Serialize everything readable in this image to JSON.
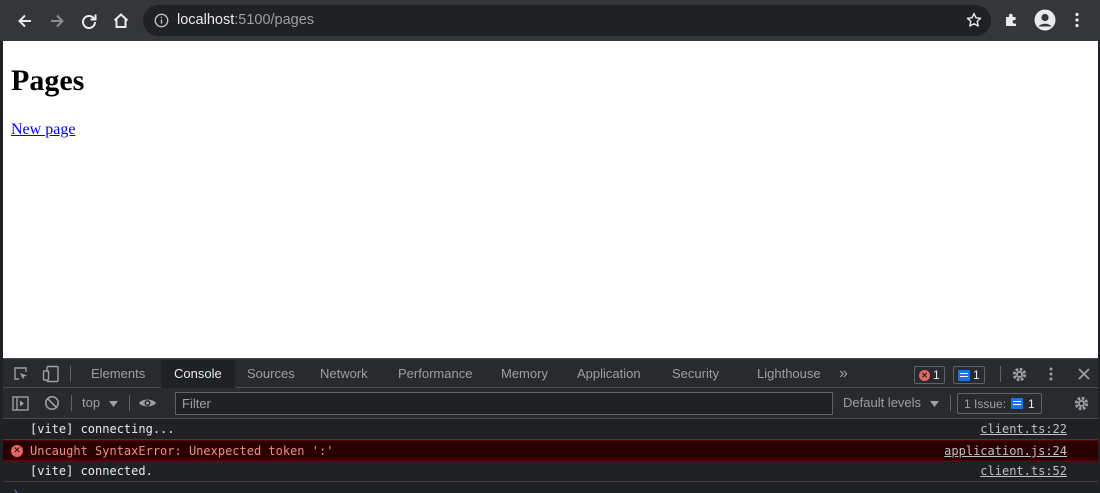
{
  "browser": {
    "url_host": "localhost",
    "url_rest": ":5100/pages"
  },
  "page": {
    "title": "Pages",
    "link_text": "New page"
  },
  "devtools": {
    "tabs": [
      {
        "label": "Elements"
      },
      {
        "label": "Console"
      },
      {
        "label": "Sources"
      },
      {
        "label": "Network"
      },
      {
        "label": "Performance"
      },
      {
        "label": "Memory"
      },
      {
        "label": "Application"
      },
      {
        "label": "Security"
      },
      {
        "label": "Lighthouse"
      }
    ],
    "active_tab": "Console",
    "overflow_label": "»",
    "error_count": "1",
    "message_count": "1",
    "context": "top",
    "filter_placeholder": "Filter",
    "levels_label": "Default levels",
    "issues_label": "1 Issue:",
    "issues_count": "1",
    "console": [
      {
        "text": "[vite] connecting...",
        "source": "client.ts:22",
        "level": "info"
      },
      {
        "text": "Uncaught SyntaxError: Unexpected token ':'",
        "source": "application.js:24",
        "level": "error"
      },
      {
        "text": "[vite] connected.",
        "source": "client.ts:52",
        "level": "info"
      }
    ]
  },
  "colors": {
    "toolbar": "#35363a",
    "devtools_bg": "#202124",
    "error_bg": "#290000",
    "error_text": "#f28b82",
    "link": "#0000ee",
    "accent": "#1a73e8"
  }
}
